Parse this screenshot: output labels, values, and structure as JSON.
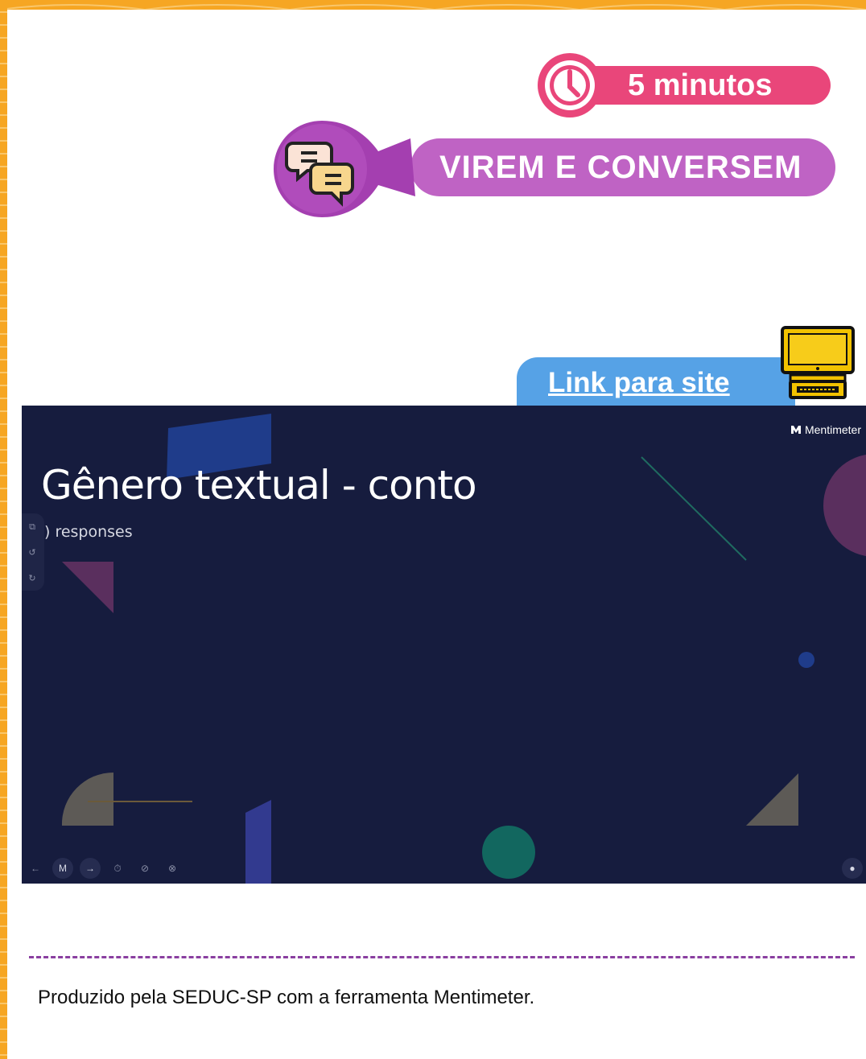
{
  "timer": {
    "label": "5 minutos",
    "color": "#e9467a"
  },
  "activity": {
    "label": "VIREM E CONVERSEM",
    "color": "#bf63c4"
  },
  "link": {
    "label": "Link para site",
    "color": "#56a2e6"
  },
  "mentimeter": {
    "brand": "Mentimeter",
    "title": "Gênero textual - conto",
    "responses": ") responses",
    "background": "#161c3e",
    "side_toolbar": [
      "copy-icon",
      "history-icon",
      "history-icon"
    ],
    "bottom_toolbar": [
      "back-arrow-icon",
      "mentimeter-logo-icon",
      "forward-arrow-icon",
      "timer-icon",
      "block-icon",
      "hide-icon"
    ],
    "user_icon": "user-icon"
  },
  "footer": {
    "text": "Produzido pela SEDUC-SP com a ferramenta Mentimeter."
  }
}
